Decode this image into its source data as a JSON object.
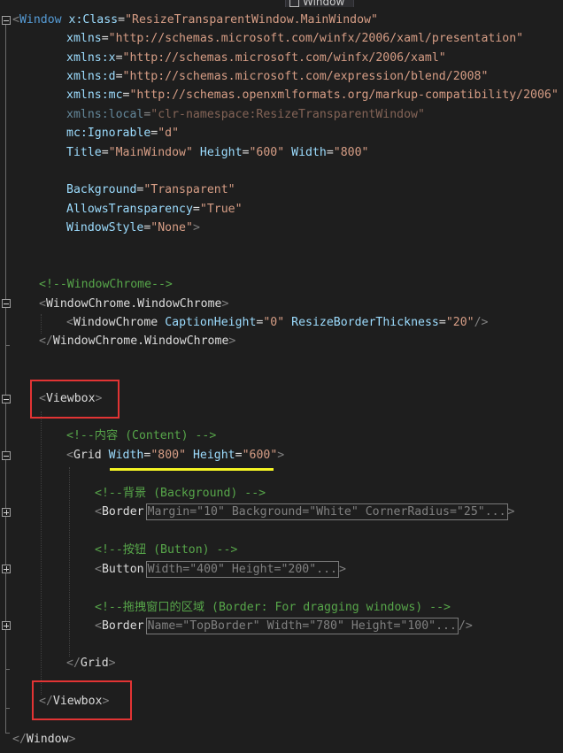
{
  "tab": {
    "label": "Window"
  },
  "code": {
    "window_open": "Window",
    "class_attr": "x:Class",
    "class_val": "\"ResizeTransparentWindow.MainWindow\"",
    "xmlns_attr": "xmlns",
    "xmlns_val": "\"http://schemas.microsoft.com/winfx/2006/xaml/presentation\"",
    "xmlns_x_attr": "xmlns:x",
    "xmlns_x_val": "\"http://schemas.microsoft.com/winfx/2006/xaml\"",
    "xmlns_d_attr": "xmlns:d",
    "xmlns_d_val": "\"http://schemas.microsoft.com/expression/blend/2008\"",
    "xmlns_mc_attr": "xmlns:mc",
    "xmlns_mc_val": "\"http://schemas.openxmlformats.org/markup-compatibility/2006\"",
    "xmlns_local_attr": "xmlns:local",
    "xmlns_local_val": "\"clr-namespace:ResizeTransparentWindow\"",
    "mc_ignorable_attr": "mc:Ignorable",
    "mc_ignorable_val": "\"d\"",
    "title_attr": "Title",
    "title_val": "\"MainWindow\"",
    "height_attr": "Height",
    "height_val": "\"600\"",
    "width_attr": "Width",
    "width_val": "\"800\"",
    "background_attr": "Background",
    "background_val": "\"Transparent\"",
    "allows_attr": "AllowsTransparency",
    "allows_val": "\"True\"",
    "windowstyle_attr": "WindowStyle",
    "windowstyle_val": "\"None\"",
    "comment_chrome": "<!--WindowChrome-->",
    "chrome_open": "WindowChrome.WindowChrome",
    "chrome_elem": "WindowChrome",
    "caption_attr": "CaptionHeight",
    "caption_val": "\"0\"",
    "resize_attr": "ResizeBorderThickness",
    "resize_val": "\"20\"",
    "chrome_close": "WindowChrome.WindowChrome",
    "viewbox_open": "Viewbox",
    "comment_content": "<!--内容 (Content) -->",
    "grid_elem": "Grid",
    "grid_width_attr": "Width",
    "grid_width_val": "\"800\"",
    "grid_height_attr": "Height",
    "grid_height_val": "\"600\"",
    "comment_background": "<!--背景 (Background) -->",
    "border_elem": "Border",
    "border1_collapsed": "Margin=\"10\" Background=\"White\" CornerRadius=\"25\"...",
    "comment_button": "<!--按钮 (Button) -->",
    "button_elem": "Button",
    "button_collapsed": "Width=\"400\" Height=\"200\"...",
    "comment_drag": "<!--拖拽窗口的区域 (Border: For dragging windows) -->",
    "border2_collapsed": "Name=\"TopBorder\" Width=\"780\" Height=\"100\"...",
    "grid_close": "Grid",
    "viewbox_close": "Viewbox",
    "window_close": "Window"
  }
}
